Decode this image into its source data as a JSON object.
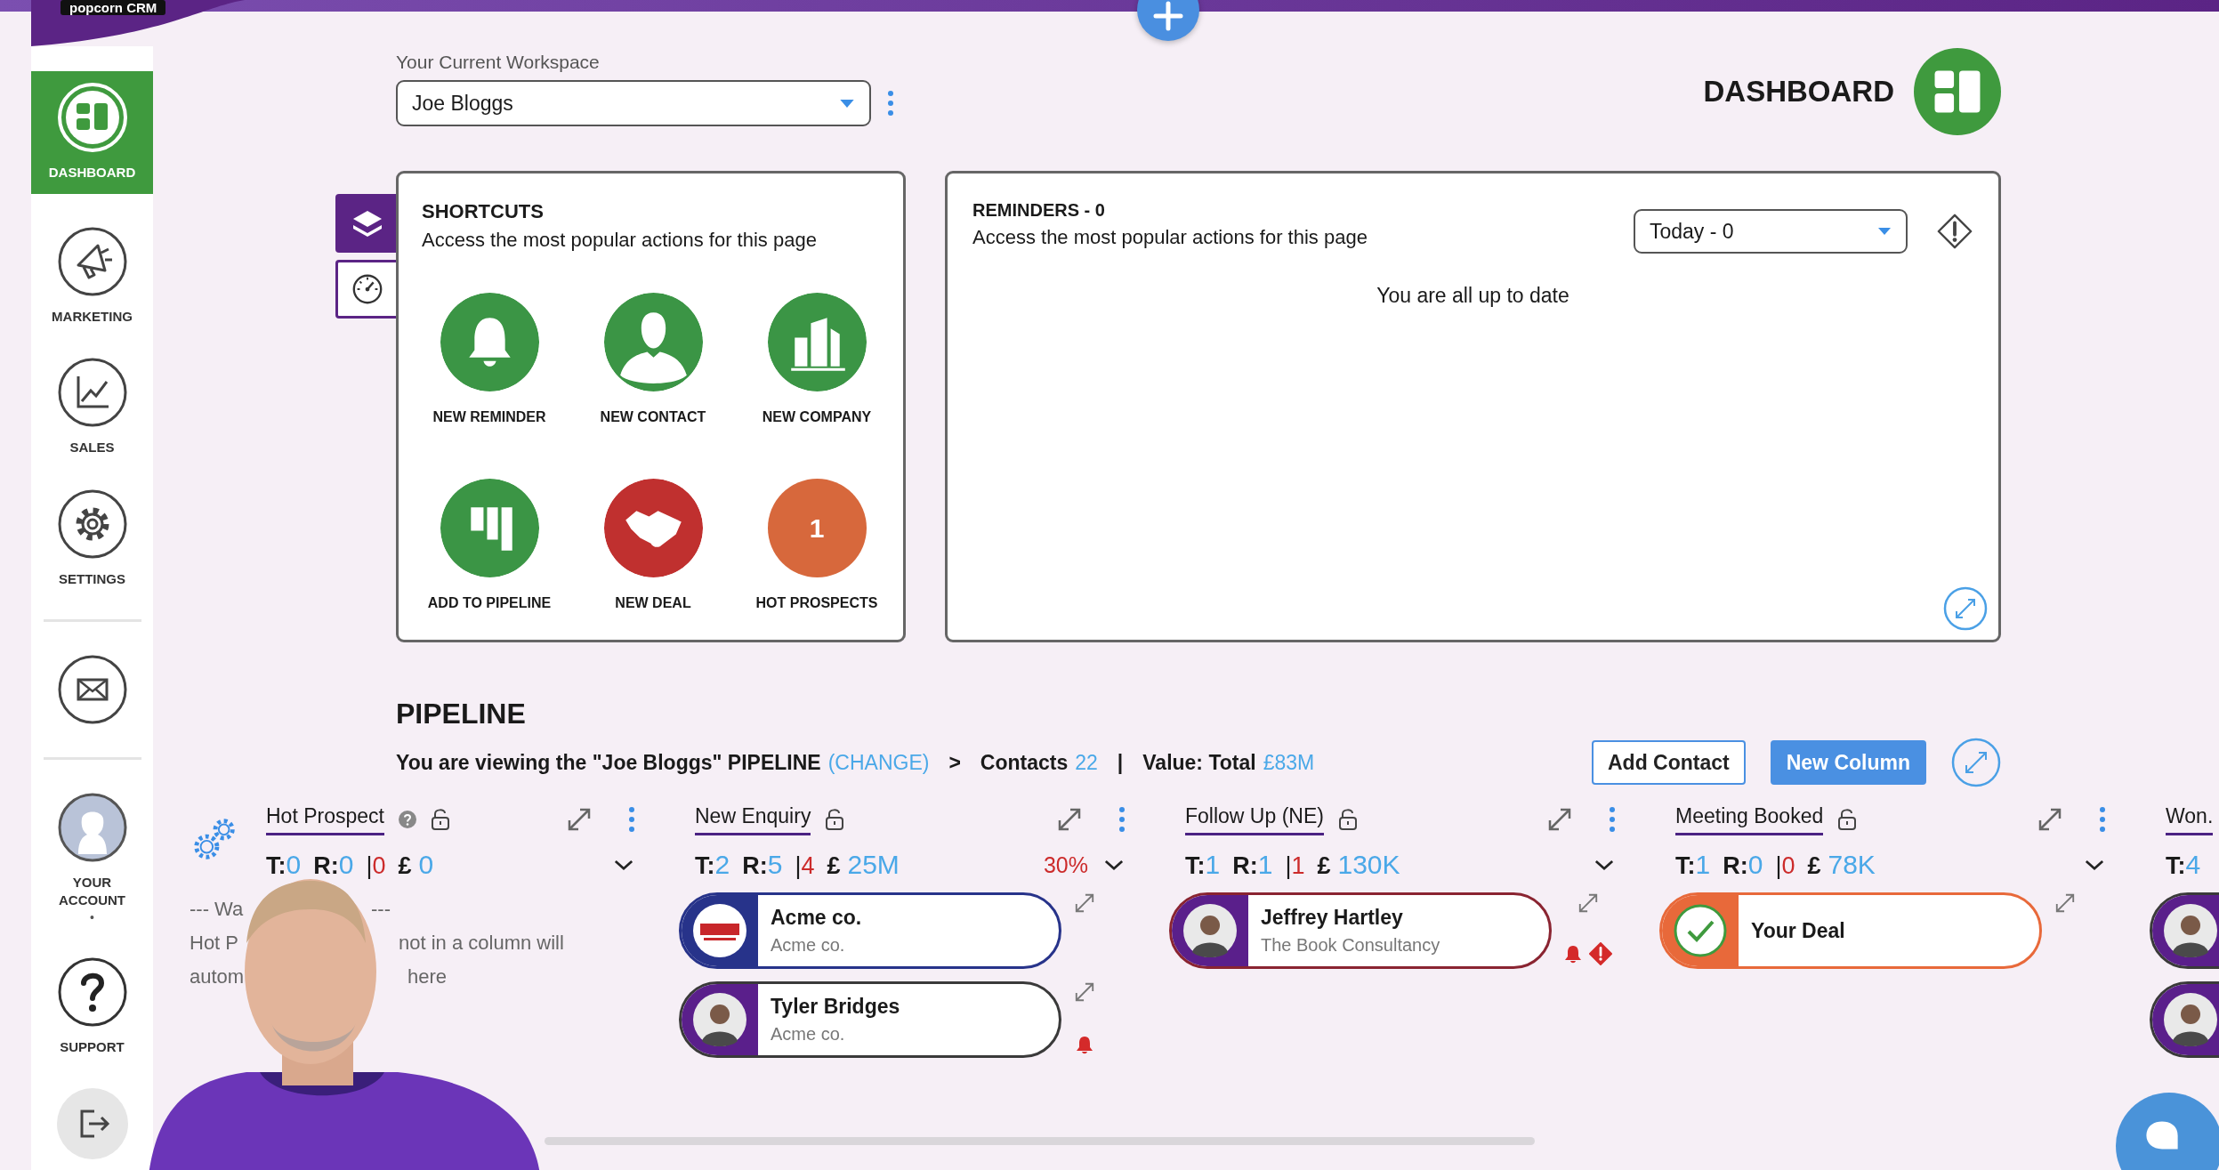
{
  "app_tag": "popcorn CRM",
  "sidebar": {
    "items": [
      {
        "kind": "dashboard",
        "label": "DASHBOARD",
        "selected": true
      },
      {
        "kind": "marketing",
        "label": "MARKETING",
        "selected": false
      },
      {
        "kind": "sales",
        "label": "SALES",
        "selected": false
      },
      {
        "kind": "settings",
        "label": "SETTINGS",
        "selected": false
      },
      {
        "kind": "divider"
      },
      {
        "kind": "mail",
        "selected": false
      },
      {
        "kind": "divider"
      },
      {
        "kind": "account",
        "label": "YOUR ACCOUNT",
        "badge": "•",
        "selected": false
      },
      {
        "kind": "support",
        "label": "SUPPORT",
        "selected": false
      },
      {
        "kind": "logout",
        "selected": false
      }
    ]
  },
  "workspace": {
    "label": "Your Current Workspace",
    "value": "Joe Bloggs"
  },
  "page_title": "DASHBOARD",
  "side_tabs": [
    {
      "kind": "layers",
      "selected": true
    },
    {
      "kind": "gauge",
      "selected": false
    }
  ],
  "shortcuts": {
    "title": "SHORTCUTS",
    "subtitle": "Access the most popular actions for this page",
    "items": [
      {
        "kind": "bell",
        "label": "NEW REMINDER",
        "color": "#3b9545"
      },
      {
        "kind": "person",
        "label": "NEW CONTACT",
        "color": "#3b9545"
      },
      {
        "kind": "building",
        "label": "NEW COMPANY",
        "color": "#3b9545"
      },
      {
        "kind": "pipeline",
        "label": "ADD TO PIPELINE",
        "color": "#3b9545"
      },
      {
        "kind": "handshake",
        "label": "NEW DEAL",
        "color": "#c0302f"
      },
      {
        "kind": "count",
        "label": "HOT PROSPECTS",
        "count": "1",
        "color": "#d7683c"
      }
    ]
  },
  "reminders": {
    "title": "REMINDERS - 0",
    "subtitle": "Access the most popular actions for this page",
    "filter": "Today - 0",
    "message": "You are all up to date"
  },
  "pipeline": {
    "title": "PIPELINE",
    "info": [
      {
        "kind": "text",
        "text": "You are viewing the \"Joe Bloggs\" PIPELINE"
      },
      {
        "kind": "link",
        "text": "(CHANGE)"
      },
      {
        "kind": "sep",
        "text": ">"
      },
      {
        "kind": "text",
        "text": "Contacts"
      },
      {
        "kind": "value",
        "text": "22"
      },
      {
        "kind": "sep",
        "text": "|"
      },
      {
        "kind": "text",
        "text": "Value: Total"
      },
      {
        "kind": "value",
        "text": "£83M"
      }
    ],
    "buttons": [
      {
        "kind": "outline",
        "label": "Add Contact"
      },
      {
        "kind": "primary",
        "label": "New Column"
      }
    ],
    "columns": [
      {
        "kind": "auto",
        "title": "Hot Prospect",
        "help": true,
        "controls": true,
        "stats": [
          {
            "kind": "label",
            "text": "T:"
          },
          {
            "kind": "count",
            "text": "0"
          },
          {
            "kind": "label",
            "text": "R:"
          },
          {
            "kind": "count",
            "text": "0"
          },
          {
            "kind": "sep",
            "text": "|"
          },
          {
            "kind": "overdue",
            "text": "0"
          },
          {
            "kind": "currency",
            "text": "£"
          },
          {
            "kind": "count",
            "text": "0"
          }
        ],
        "hint": [
          [
            "--- Wa",
            "---"
          ],
          [
            "Hot P",
            "not in a column will"
          ],
          [
            "autom",
            "here"
          ]
        ]
      },
      {
        "kind": "stage",
        "title": "New Enquiry",
        "help": false,
        "controls": true,
        "percent": "30%",
        "stats": [
          {
            "kind": "label",
            "text": "T:"
          },
          {
            "kind": "count",
            "text": "2"
          },
          {
            "kind": "label",
            "text": "R:"
          },
          {
            "kind": "count",
            "text": "5"
          },
          {
            "kind": "sep",
            "text": "|"
          },
          {
            "kind": "overdue",
            "text": "4"
          },
          {
            "kind": "currency",
            "text": "£"
          },
          {
            "kind": "count",
            "text": "25M"
          }
        ],
        "cards": [
          {
            "kind": "logo",
            "name": "Acme co.",
            "subtitle": "Acme co.",
            "accent": {
              "color": "#27338a"
            },
            "outline": {
              "color": "#27338a"
            },
            "reminder": false,
            "alert": false,
            "expand": true
          },
          {
            "name": "Tyler Bridges",
            "subtitle": "Acme co.",
            "accent": {
              "color": "#5a1f8b"
            },
            "outline": {
              "color": "#3a3a3a"
            },
            "reminder": true,
            "alert": false,
            "expand": true
          }
        ]
      },
      {
        "kind": "stage",
        "title": "Follow Up (NE)",
        "help": false,
        "controls": true,
        "stats": [
          {
            "kind": "label",
            "text": "T:"
          },
          {
            "kind": "count",
            "text": "1"
          },
          {
            "kind": "label",
            "text": "R:"
          },
          {
            "kind": "count",
            "text": "1"
          },
          {
            "kind": "sep",
            "text": "|"
          },
          {
            "kind": "overdue",
            "text": "1"
          },
          {
            "kind": "currency",
            "text": "£"
          },
          {
            "kind": "count",
            "text": "130K"
          }
        ],
        "cards": [
          {
            "name": "Jeffrey Hartley",
            "subtitle": "The Book Consultancy",
            "accent": {
              "color": "#5a1f8b"
            },
            "outline": {
              "color": "#8a2431"
            },
            "reminder": true,
            "alert": true,
            "expand": true
          }
        ]
      },
      {
        "kind": "stage",
        "title": "Meeting Booked",
        "help": false,
        "controls": true,
        "stats": [
          {
            "kind": "label",
            "text": "T:"
          },
          {
            "kind": "count",
            "text": "1"
          },
          {
            "kind": "label",
            "text": "R:"
          },
          {
            "kind": "count",
            "text": "0"
          },
          {
            "kind": "sep",
            "text": "|"
          },
          {
            "kind": "overdue",
            "text": "0"
          },
          {
            "kind": "currency",
            "text": "£"
          },
          {
            "kind": "count",
            "text": "78K"
          }
        ],
        "cards": [
          {
            "kind": "check",
            "name": "Your Deal",
            "accent": {
              "color": "#e8693a"
            },
            "outline": {
              "color": "#e8693a"
            },
            "reminder": false,
            "alert": false,
            "expand": true
          }
        ]
      },
      {
        "kind": "stage",
        "title": "Won.",
        "help": false,
        "controls": false,
        "stats": [
          {
            "kind": "label",
            "text": "T:"
          },
          {
            "kind": "count",
            "text": "4"
          }
        ],
        "cards": [
          {
            "accent": {
              "color": "#5a1f8b"
            },
            "outline": {
              "color": "#3a3a3a"
            }
          },
          {
            "accent": {
              "color": "#5a1f8b"
            },
            "outline": {
              "color": "#3a3a3a"
            }
          }
        ]
      }
    ]
  }
}
